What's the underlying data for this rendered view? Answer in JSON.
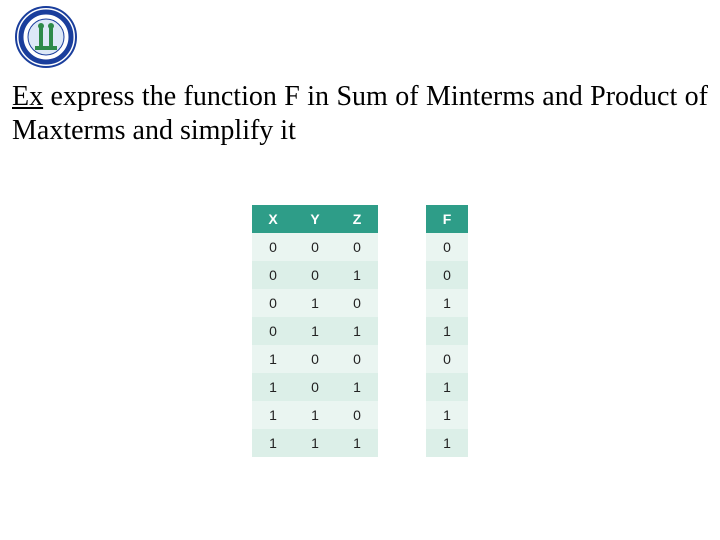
{
  "title": {
    "ex": "Ex",
    "rest": " express the function F in Sum of Minterms and Product of Maxterms and simplify it"
  },
  "table": {
    "headers": [
      "X",
      "Y",
      "Z",
      "F"
    ],
    "rows": [
      {
        "x": "0",
        "y": "0",
        "z": "0",
        "f": "0"
      },
      {
        "x": "0",
        "y": "0",
        "z": "1",
        "f": "0"
      },
      {
        "x": "0",
        "y": "1",
        "z": "0",
        "f": "1"
      },
      {
        "x": "0",
        "y": "1",
        "z": "1",
        "f": "1"
      },
      {
        "x": "1",
        "y": "0",
        "z": "0",
        "f": "0"
      },
      {
        "x": "1",
        "y": "0",
        "z": "1",
        "f": "1"
      },
      {
        "x": "1",
        "y": "1",
        "z": "0",
        "f": "1"
      },
      {
        "x": "1",
        "y": "1",
        "z": "1",
        "f": "1"
      }
    ]
  },
  "colors": {
    "header_bg": "#2e9d88",
    "row_alt1": "#eaf5f1",
    "row_alt2": "#dcefe8"
  }
}
